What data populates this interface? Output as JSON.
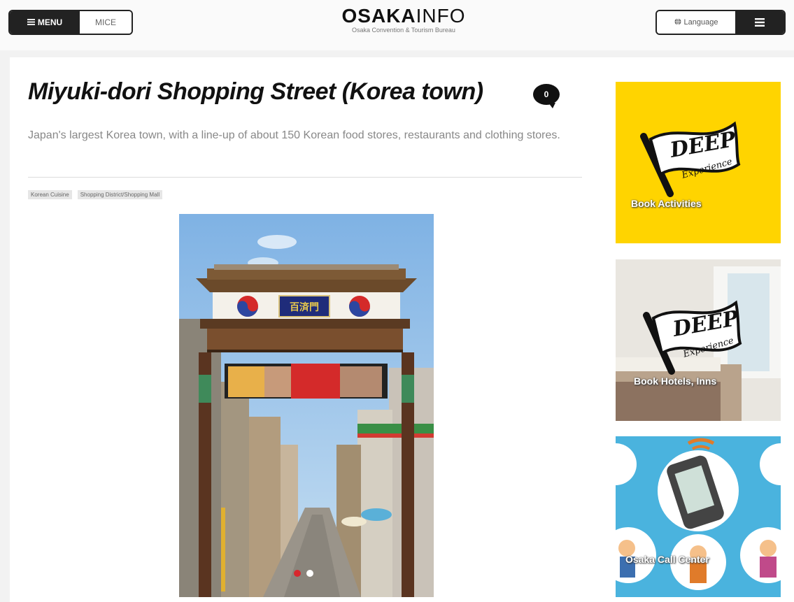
{
  "header": {
    "menu_label": "MENU",
    "mice_label": "MICE",
    "logo_bold": "OSAKA",
    "logo_light": "INFO",
    "logo_subtitle": "Osaka Convention & Tourism Bureau",
    "language_label": "Language"
  },
  "article": {
    "title": "Miyuki-dori Shopping Street (Korea town)",
    "comment_count": "0",
    "description": "Japan's largest Korea town, with a line-up of about 150 Korean food stores, restaurants and clothing stores.",
    "tags": [
      "Korean Cuisine",
      "Shopping District/Shopping Mall"
    ]
  },
  "photo": {
    "gate_sign": "百済門",
    "carousel_active_color": "#d8282e",
    "carousel_inactive_color": "#ffffff"
  },
  "sidebar": {
    "banners": [
      {
        "flag_text": "DEEP",
        "flag_sub": "Experience",
        "label": "Book Activities",
        "bg": "#ffd400"
      },
      {
        "flag_text": "DEEP",
        "flag_sub": "Experience",
        "label": "Book Hotels, Inns",
        "bg": "#ece9e4"
      },
      {
        "label": "Osaka Call Center",
        "bg": "#4ab3de"
      }
    ]
  },
  "colors": {
    "brand_dark": "#222222",
    "accent_yellow": "#ffd400",
    "accent_blue": "#4ab3de"
  }
}
